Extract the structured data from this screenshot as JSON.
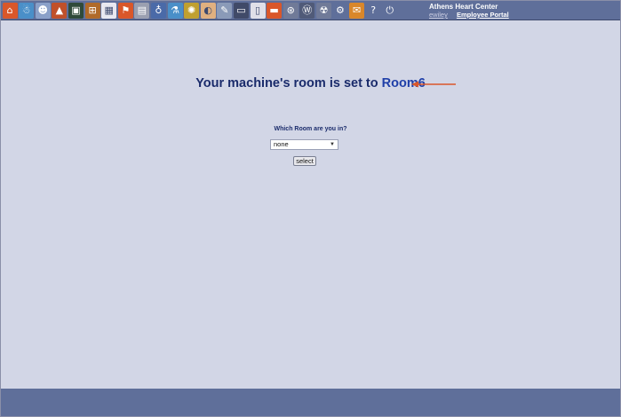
{
  "toolbar": {
    "brand": "Athens Heart Center",
    "user": "ewiley",
    "portal_link": "Employee Portal",
    "icons": [
      {
        "name": "home-icon",
        "glyph": "⌂",
        "color": "#d9572a"
      },
      {
        "name": "snowman-icon",
        "glyph": "☃",
        "color": "#4a8fc8"
      },
      {
        "name": "doctor-icon",
        "glyph": "☻",
        "color": "#8aa0c8"
      },
      {
        "name": "chart-icon",
        "glyph": "▲",
        "color": "#c0502a"
      },
      {
        "name": "monitor-icon",
        "glyph": "▣",
        "color": "#2f4a3a"
      },
      {
        "name": "cart-icon",
        "glyph": "⊞",
        "color": "#b06a2a"
      },
      {
        "name": "calendar-icon",
        "glyph": "▦",
        "color": "#e8e8f0"
      },
      {
        "name": "flag-icon",
        "glyph": "⚑",
        "color": "#d9572a"
      },
      {
        "name": "notepad-icon",
        "glyph": "▤",
        "color": "#9a9fb0"
      },
      {
        "name": "stethoscope-icon",
        "glyph": "♁",
        "color": "#4a6aa8"
      },
      {
        "name": "flask-icon",
        "glyph": "⚗",
        "color": "#4a8fc8"
      },
      {
        "name": "gear-badge-icon",
        "glyph": "✺",
        "color": "#c0a030"
      },
      {
        "name": "pills-icon",
        "glyph": "◐",
        "color": "#e0b080"
      },
      {
        "name": "syringe-icon",
        "glyph": "✎",
        "color": "#8a9ab8"
      },
      {
        "name": "id-card-icon",
        "glyph": "▭",
        "color": "#404a68"
      },
      {
        "name": "document-icon",
        "glyph": "▯",
        "color": "#e0e0e8"
      },
      {
        "name": "folder-icon",
        "glyph": "▬",
        "color": "#d9572a"
      },
      {
        "name": "steering-wheel-icon",
        "glyph": "⊛",
        "color": "#707a98"
      },
      {
        "name": "wordpress-icon",
        "glyph": "Ⓦ",
        "color": "#505a78"
      },
      {
        "name": "bug-icon",
        "glyph": "☢",
        "color": "#707a98"
      },
      {
        "name": "settings-icon",
        "glyph": "⚙",
        "color": "#5f6f9a"
      },
      {
        "name": "mail-icon",
        "glyph": "✉",
        "color": "#d9872a"
      },
      {
        "name": "help-icon",
        "glyph": "?",
        "color": "#5f6f9a"
      },
      {
        "name": "power-icon",
        "glyph": "⏻",
        "color": "#5f6f9a"
      }
    ]
  },
  "main": {
    "heading_prefix": "Your machine's room is set to ",
    "heading_room": "Room6",
    "question": "Which Room are you in?",
    "select_value": "none",
    "select_button": "select"
  },
  "colors": {
    "toolbar_bg": "#5f6f9a",
    "page_bg": "#d2d6e6",
    "heading": "#1a2b6b",
    "room_accent": "#1f3fa8",
    "arrow": "#d9572a"
  }
}
